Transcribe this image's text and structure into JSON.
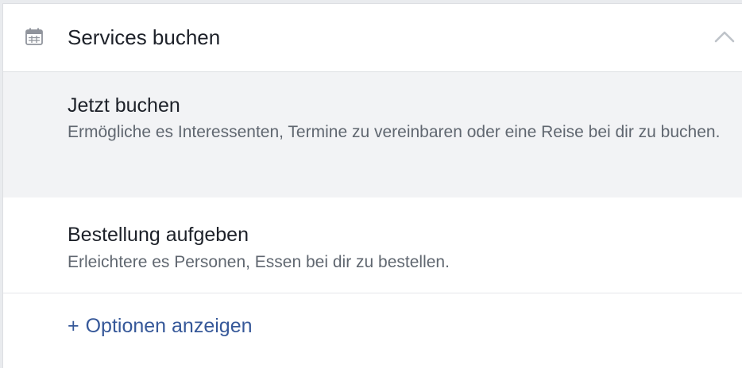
{
  "section": {
    "icon": "calendar-icon",
    "title": "Services buchen",
    "collapse_icon": "chevron-up-icon"
  },
  "options": [
    {
      "title": "Jetzt buchen",
      "description": "Ermögliche es Interessenten, Termine zu vereinbaren oder eine Reise bei dir zu buchen.",
      "selected": true
    },
    {
      "title": "Bestellung aufgeben",
      "description": "Erleichtere es Personen, Essen bei dir zu bestellen.",
      "selected": false
    }
  ],
  "more_link": {
    "icon": "plus-icon",
    "plus": "+",
    "label": "Optionen anzeigen"
  },
  "colors": {
    "link": "#365899",
    "selected_bg": "#f2f3f5",
    "text_primary": "#1d2129",
    "text_secondary": "#606770"
  }
}
